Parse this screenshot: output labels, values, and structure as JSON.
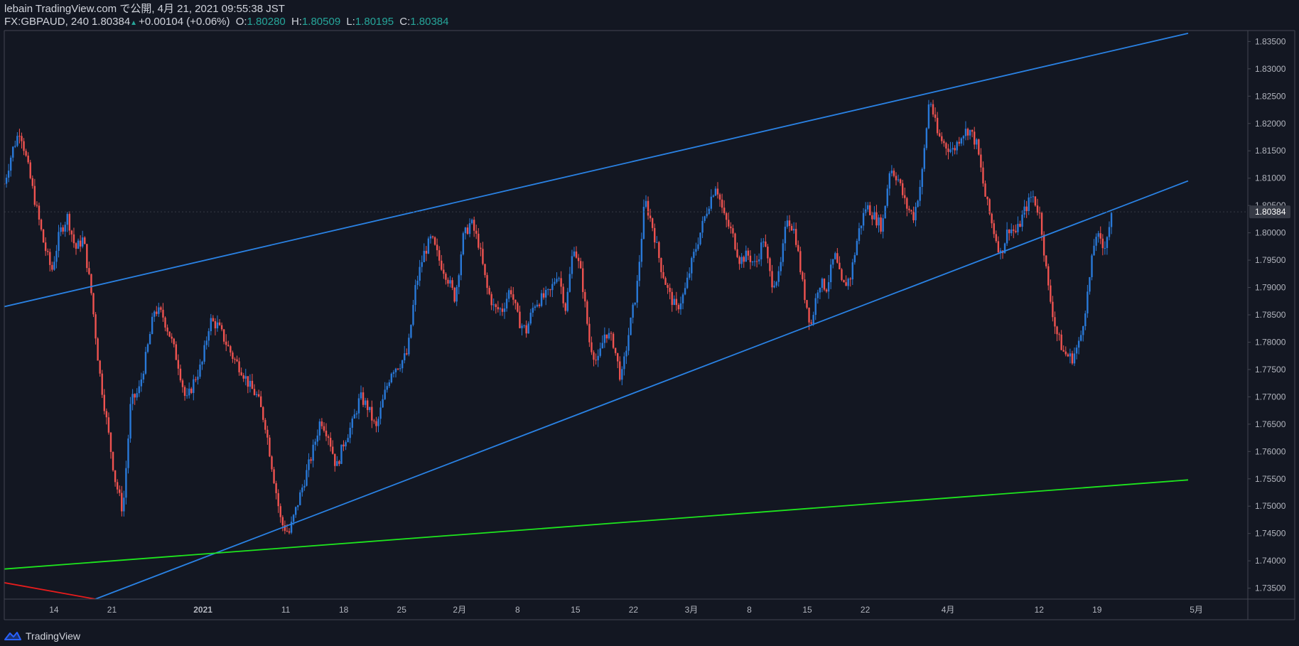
{
  "header": {
    "title": "lebain TradingView.com で公開, 4月 21, 2021 09:55:38 JST",
    "symbol": "FX:GBPAUD, 240",
    "last": "1.80384",
    "change": "+0.00104 (+0.06%)",
    "o_label": "O:",
    "o_value": "1.80280",
    "h_label": "H:",
    "h_value": "1.80509",
    "l_label": "L:",
    "l_value": "1.80195",
    "c_label": "C:",
    "c_value": "1.80384",
    "arrow_icon": "triangle-up-icon"
  },
  "footer": {
    "brand": "TradingView",
    "logo_icon": "tradingview-logo-icon"
  },
  "colors": {
    "background": "#131722",
    "bull": "#2979d8",
    "bear": "#ef5350",
    "channel": "#2a82e4",
    "support": "#1ee61e",
    "red_line": "#e81c1c",
    "axis_text": "#b2b5be",
    "border": "#363a45"
  },
  "chart_data": {
    "type": "candlestick",
    "symbol": "FX:GBPAUD",
    "interval": "240",
    "ylim": [
      1.733,
      1.837
    ],
    "y_ticks": [
      "1.83500",
      "1.83000",
      "1.82500",
      "1.82000",
      "1.81500",
      "1.81000",
      "1.80500",
      "1.80000",
      "1.79500",
      "1.79000",
      "1.78500",
      "1.78000",
      "1.77500",
      "1.77000",
      "1.76500",
      "1.76000",
      "1.75500",
      "1.75000",
      "1.74500",
      "1.74000",
      "1.73500"
    ],
    "x_ticks": [
      "14",
      "21",
      "2021",
      "11",
      "18",
      "25",
      "2月",
      "8",
      "15",
      "22",
      "3月",
      "8",
      "15",
      "22",
      "4月",
      "12",
      "19",
      "5月"
    ],
    "last_price_label": "1.80384",
    "close_path": [
      1.809,
      1.815,
      1.819,
      1.812,
      1.805,
      1.798,
      1.793,
      1.8,
      1.803,
      1.797,
      1.799,
      1.789,
      1.775,
      1.765,
      1.755,
      1.749,
      1.769,
      1.771,
      1.778,
      1.786,
      1.785,
      1.781,
      1.776,
      1.769,
      1.773,
      1.776,
      1.784,
      1.783,
      1.78,
      1.777,
      1.775,
      1.772,
      1.77,
      1.765,
      1.756,
      1.747,
      1.745,
      1.75,
      1.755,
      1.76,
      1.766,
      1.763,
      1.757,
      1.762,
      1.765,
      1.77,
      1.768,
      1.764,
      1.77,
      1.775,
      1.776,
      1.778,
      1.79,
      1.796,
      1.799,
      1.795,
      1.792,
      1.788,
      1.799,
      1.802,
      1.798,
      1.79,
      1.786,
      1.786,
      1.79,
      1.784,
      1.782,
      1.787,
      1.788,
      1.789,
      1.793,
      1.786,
      1.798,
      1.792,
      1.78,
      1.776,
      1.782,
      1.78,
      1.773,
      1.782,
      1.79,
      1.806,
      1.801,
      1.794,
      1.789,
      1.786,
      1.789,
      1.795,
      1.8,
      1.805,
      1.809,
      1.803,
      1.8,
      1.795,
      1.796,
      1.794,
      1.799,
      1.791,
      1.792,
      1.803,
      1.8,
      1.79,
      1.783,
      1.791,
      1.79,
      1.796,
      1.79,
      1.792,
      1.8,
      1.805,
      1.803,
      1.801,
      1.812,
      1.81,
      1.805,
      1.803,
      1.81,
      1.825,
      1.818,
      1.816,
      1.815,
      1.818,
      1.819,
      1.816,
      1.807,
      1.801,
      1.796,
      1.801,
      1.8,
      1.804,
      1.807,
      1.803,
      1.79,
      1.782,
      1.778,
      1.777,
      1.78,
      1.789,
      1.8,
      1.797,
      1.803
    ],
    "close_path_x_range": [
      "2020-12-08",
      "2021-04-21"
    ],
    "lines": [
      {
        "name": "upper channel",
        "color": "#2a82e4",
        "from": [
          "2020-12-08",
          1.7865
        ],
        "to": [
          "2021-04-30",
          1.8365
        ]
      },
      {
        "name": "lower trendline",
        "color": "#2a82e4",
        "from": [
          "2020-12-19",
          1.733
        ],
        "to": [
          "2021-04-30",
          1.8095
        ]
      },
      {
        "name": "support",
        "color": "#1ee61e",
        "from": [
          "2020-12-08",
          1.7385
        ],
        "to": [
          "2021-04-30",
          1.7548
        ]
      },
      {
        "name": "falling",
        "color": "#e81c1c",
        "from": [
          "2020-12-08",
          1.736
        ],
        "to": [
          "2020-12-19",
          1.733
        ]
      }
    ],
    "grid": false,
    "legend": "top-left"
  }
}
